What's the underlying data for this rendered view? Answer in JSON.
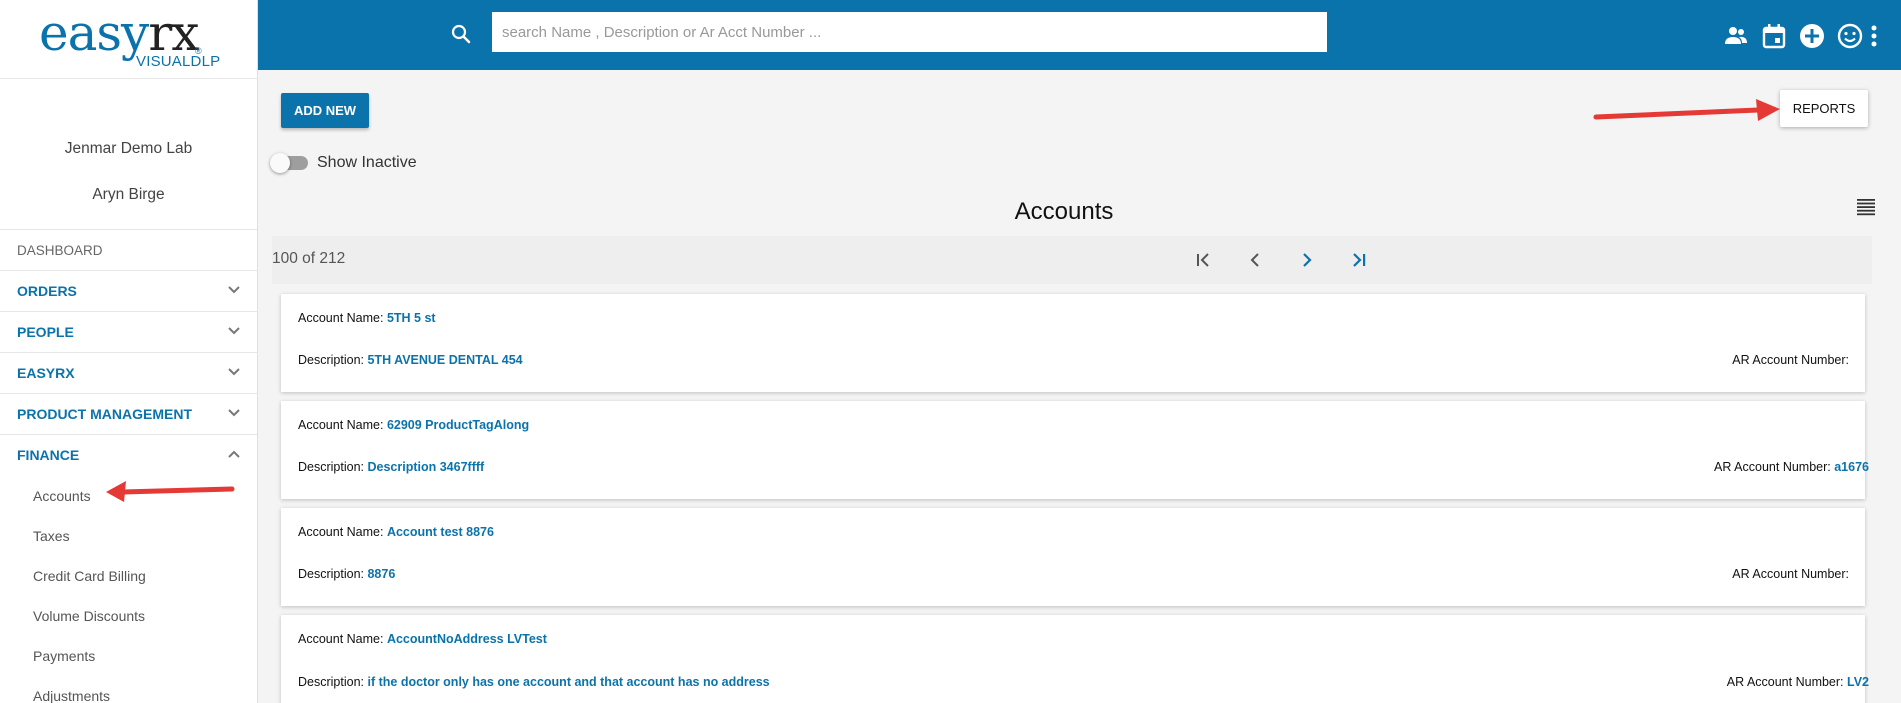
{
  "logo": {
    "brand_main": "easy",
    "brand_rx": "rx",
    "reg": "®",
    "sub": "VISUALDLP"
  },
  "user": {
    "lab": "Jenmar Demo Lab",
    "name": "Aryn Birge"
  },
  "nav": {
    "dashboard": "DASHBOARD",
    "groups": [
      {
        "label": "ORDERS",
        "expanded": false
      },
      {
        "label": "PEOPLE",
        "expanded": false
      },
      {
        "label": "EASYRX",
        "expanded": false
      },
      {
        "label": "PRODUCT MANAGEMENT",
        "expanded": false
      },
      {
        "label": "FINANCE",
        "expanded": true
      }
    ],
    "finance_items": [
      "Accounts",
      "Taxes",
      "Credit Card Billing",
      "Volume Discounts",
      "Payments",
      "Adjustments"
    ]
  },
  "header": {
    "search_placeholder": "search Name , Description or Ar Acct Number ...",
    "icons": [
      "people-icon",
      "calendar-icon",
      "add-circle-icon",
      "smiley-icon",
      "more-vert-icon"
    ]
  },
  "toolbar": {
    "add_new": "ADD NEW",
    "reports": "REPORTS",
    "show_inactive": "Show Inactive",
    "show_inactive_on": false
  },
  "page": {
    "title": "Accounts",
    "count": "100 of 212"
  },
  "labels": {
    "account_name": "Account Name: ",
    "description": "Description: ",
    "ar_account": "AR Account Number: "
  },
  "accounts": [
    {
      "name": "5TH 5 st",
      "description": "5TH AVENUE DENTAL 454",
      "ar": ""
    },
    {
      "name": "62909 ProductTagAlong",
      "description": "Description 3467ffff",
      "ar": "a1676"
    },
    {
      "name": "Account test 8876",
      "description": "8876",
      "ar": ""
    },
    {
      "name": "AccountNoAddress LVTest",
      "description": "if the doctor only has one account and that account has no address",
      "ar": "LV2"
    }
  ],
  "colors": {
    "brand": "#0b73ab",
    "arrow": "#e53935"
  }
}
